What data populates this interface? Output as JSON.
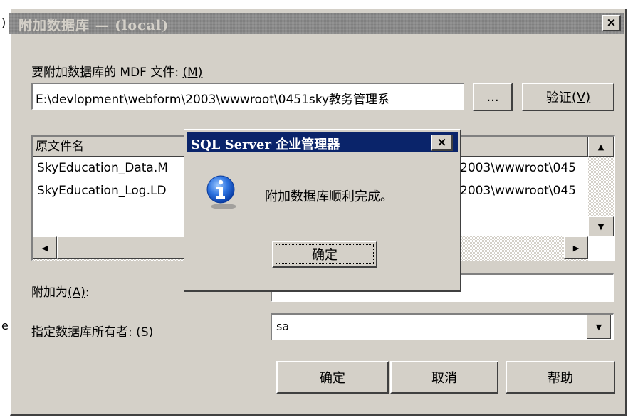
{
  "main_window": {
    "title_prefix": ")",
    "title": "附加数据库 — (local)",
    "close_label": "×",
    "mdf_label": "要附加数据库的 MDF 文件: ",
    "mdf_hotkey": "(M)",
    "mdf_value": "E:\\devlopment\\webform\\2003\\wwwroot\\0451sky教务管理系",
    "browse_label": "...",
    "verify_label": "验证",
    "verify_hotkey": "(V)",
    "file_list": {
      "header_col1": "原文件名",
      "rows": [
        {
          "name": "SkyEducation_Data.M",
          "path": "2003\\wwwroot\\045"
        },
        {
          "name": "SkyEducation_Log.LD",
          "path": "2003\\wwwroot\\045"
        }
      ]
    },
    "attach_as_label": "附加为",
    "attach_as_hotkey": "(A)",
    "attach_as_suffix": ":",
    "owner_label": "指定数据库所有者: ",
    "owner_hotkey": "(S)",
    "owner_value": "sa",
    "ok_label": "确定",
    "cancel_label": "取消",
    "help_label": "帮助"
  },
  "left_stray_char": "e",
  "message_box": {
    "title": "SQL Server 企业管理器",
    "close_label": "×",
    "icon": "info-icon",
    "message": "附加数据库顺利完成。",
    "ok_label": "确定"
  },
  "colors": {
    "dialog_face": "#d4d0c8",
    "active_title": "#0a246a",
    "inactive_title": "#808080",
    "info_blue": "#1a5fd0"
  }
}
